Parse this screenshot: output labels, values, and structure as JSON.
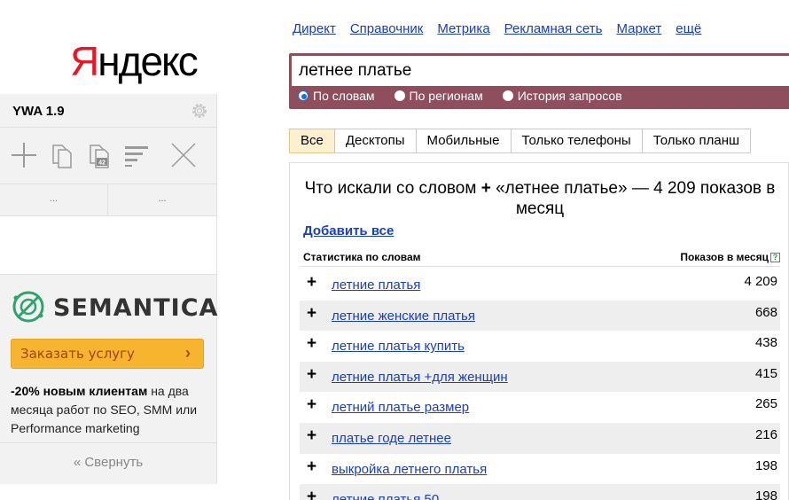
{
  "logo": {
    "first_letter": "Я",
    "rest": "ндекс"
  },
  "ywa": {
    "title": "YWA 1.9",
    "dots_left": "...",
    "dots_right": "...",
    "collapse_label": "« Свернуть"
  },
  "ad": {
    "brand": "SEMANTICA",
    "order_label": "Заказать услугу",
    "order_arrow": "›",
    "promo_bold": "-20% новым клиентам",
    "promo_rest": " на два месяца работ по SEO, SMM или Performance marketing"
  },
  "nav": [
    "Директ",
    "Справочник",
    "Метрика",
    "Рекламная сеть",
    "Маркет",
    "ещё"
  ],
  "search": {
    "value": "летнее платье",
    "modes": [
      {
        "label": "По словам",
        "selected": true
      },
      {
        "label": "По регионам",
        "selected": false
      },
      {
        "label": "История запросов",
        "selected": false
      }
    ]
  },
  "tabs": [
    {
      "label": "Все",
      "active": true
    },
    {
      "label": "Десктопы",
      "active": false
    },
    {
      "label": "Мобильные",
      "active": false
    },
    {
      "label": "Только телефоны",
      "active": false
    },
    {
      "label": "Только планш",
      "active": false
    }
  ],
  "results": {
    "heading_pre": "Что искали со словом",
    "heading_plus": "+",
    "heading_post": "«летнее платье» — 4 209 показов в месяц",
    "add_all": "Добавить все",
    "col_left": "Статистика по словам",
    "col_right": "Показов в месяц",
    "help_mark": "?",
    "rows": [
      {
        "phrase": "летние платья",
        "count": "4 209"
      },
      {
        "phrase": "летние женские платья",
        "count": "668"
      },
      {
        "phrase": "летние платья купить",
        "count": "438"
      },
      {
        "phrase": "летние платья +для женщин",
        "count": "415"
      },
      {
        "phrase": "летний платье размер",
        "count": "265"
      },
      {
        "phrase": "платье годе летнее",
        "count": "216"
      },
      {
        "phrase": "выкройка летнего платья",
        "count": "198"
      },
      {
        "phrase": "летние платья 50",
        "count": "198"
      }
    ]
  },
  "colors": {
    "brand_red": "#e3192b",
    "search_frame": "#8f4e5c",
    "link": "#1a3dc1",
    "order_button": "#f7b52f",
    "semantica_green": "#2fa36b"
  }
}
